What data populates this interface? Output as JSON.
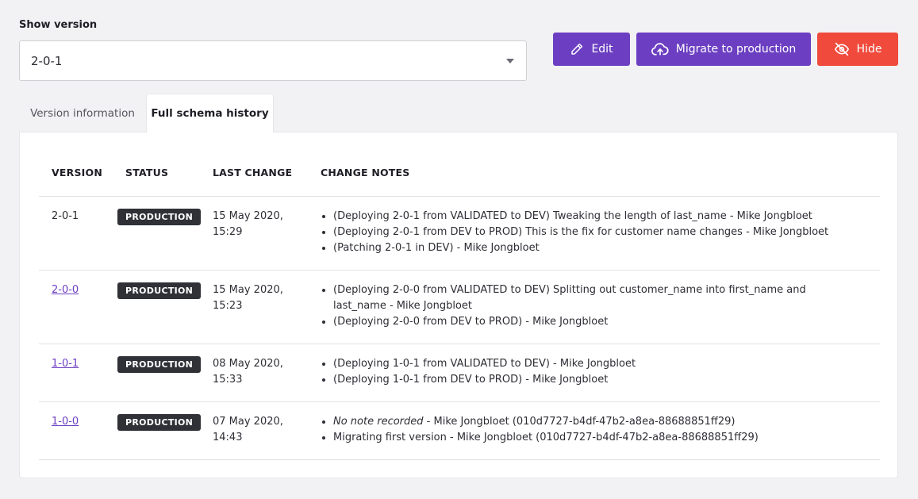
{
  "version_selector": {
    "label": "Show version",
    "selected": "2-0-1"
  },
  "toolbar": {
    "edit_label": "Edit",
    "migrate_label": "Migrate to production",
    "hide_label": "Hide"
  },
  "tabs": [
    {
      "label": "Version information",
      "active": false
    },
    {
      "label": "Full schema history",
      "active": true
    }
  ],
  "table": {
    "headers": [
      "VERSION",
      "STATUS",
      "LAST CHANGE",
      "CHANGE NOTES"
    ],
    "rows": [
      {
        "version": "2-0-1",
        "is_link": false,
        "status": "PRODUCTION",
        "last_change": [
          "15 May 2020,",
          "15:29"
        ],
        "notes": [
          {
            "text": "(Deploying 2-0-1 from VALIDATED to DEV) Tweaking the length of last_name - Mike Jongbloet"
          },
          {
            "text": "(Deploying 2-0-1 from DEV to PROD) This is the fix for customer name changes - Mike Jongbloet"
          },
          {
            "text": "(Patching 2-0-1 in DEV) - Mike Jongbloet"
          }
        ]
      },
      {
        "version": "2-0-0",
        "is_link": true,
        "status": "PRODUCTION",
        "last_change": [
          "15 May 2020,",
          "15:23"
        ],
        "notes": [
          {
            "text": "(Deploying 2-0-0 from VALIDATED to DEV) Splitting out customer_name into first_name and",
            "cont": "last_name - Mike Jongbloet"
          },
          {
            "text": "(Deploying 2-0-0 from DEV to PROD) - Mike Jongbloet"
          }
        ]
      },
      {
        "version": "1-0-1",
        "is_link": true,
        "status": "PRODUCTION",
        "last_change": [
          "08 May 2020,",
          "15:33"
        ],
        "notes": [
          {
            "text": "(Deploying 1-0-1 from VALIDATED to DEV) - Mike Jongbloet"
          },
          {
            "text": "(Deploying 1-0-1 from DEV to PROD) - Mike Jongbloet"
          }
        ]
      },
      {
        "version": "1-0-0",
        "is_link": true,
        "status": "PRODUCTION",
        "last_change": [
          "07 May 2020,",
          "14:43"
        ],
        "notes": [
          {
            "italic": "No note recorded",
            "text": " - Mike Jongbloet (010d7727-b4df-47b2-a8ea-88688851ff29)"
          },
          {
            "text": "Migrating first version - Mike Jongbloet (010d7727-b4df-47b2-a8ea-88688851ff29)"
          }
        ]
      }
    ]
  },
  "colors": {
    "accent": "#6c3fc2",
    "danger": "#ef4a3c",
    "badge": "#2f3137"
  }
}
